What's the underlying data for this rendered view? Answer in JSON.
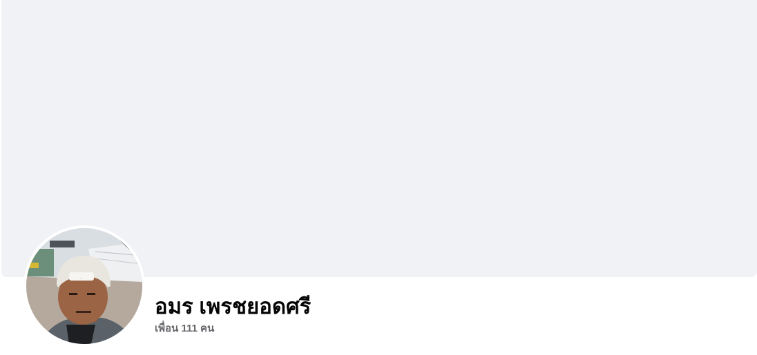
{
  "profile": {
    "name": "อมร เพรชยอดศรี",
    "friends_count_label": "เพื่อน 111 คน"
  },
  "colors": {
    "cover_background": "#f0f2f5",
    "name_text": "#050505",
    "secondary_text": "#65676b"
  }
}
